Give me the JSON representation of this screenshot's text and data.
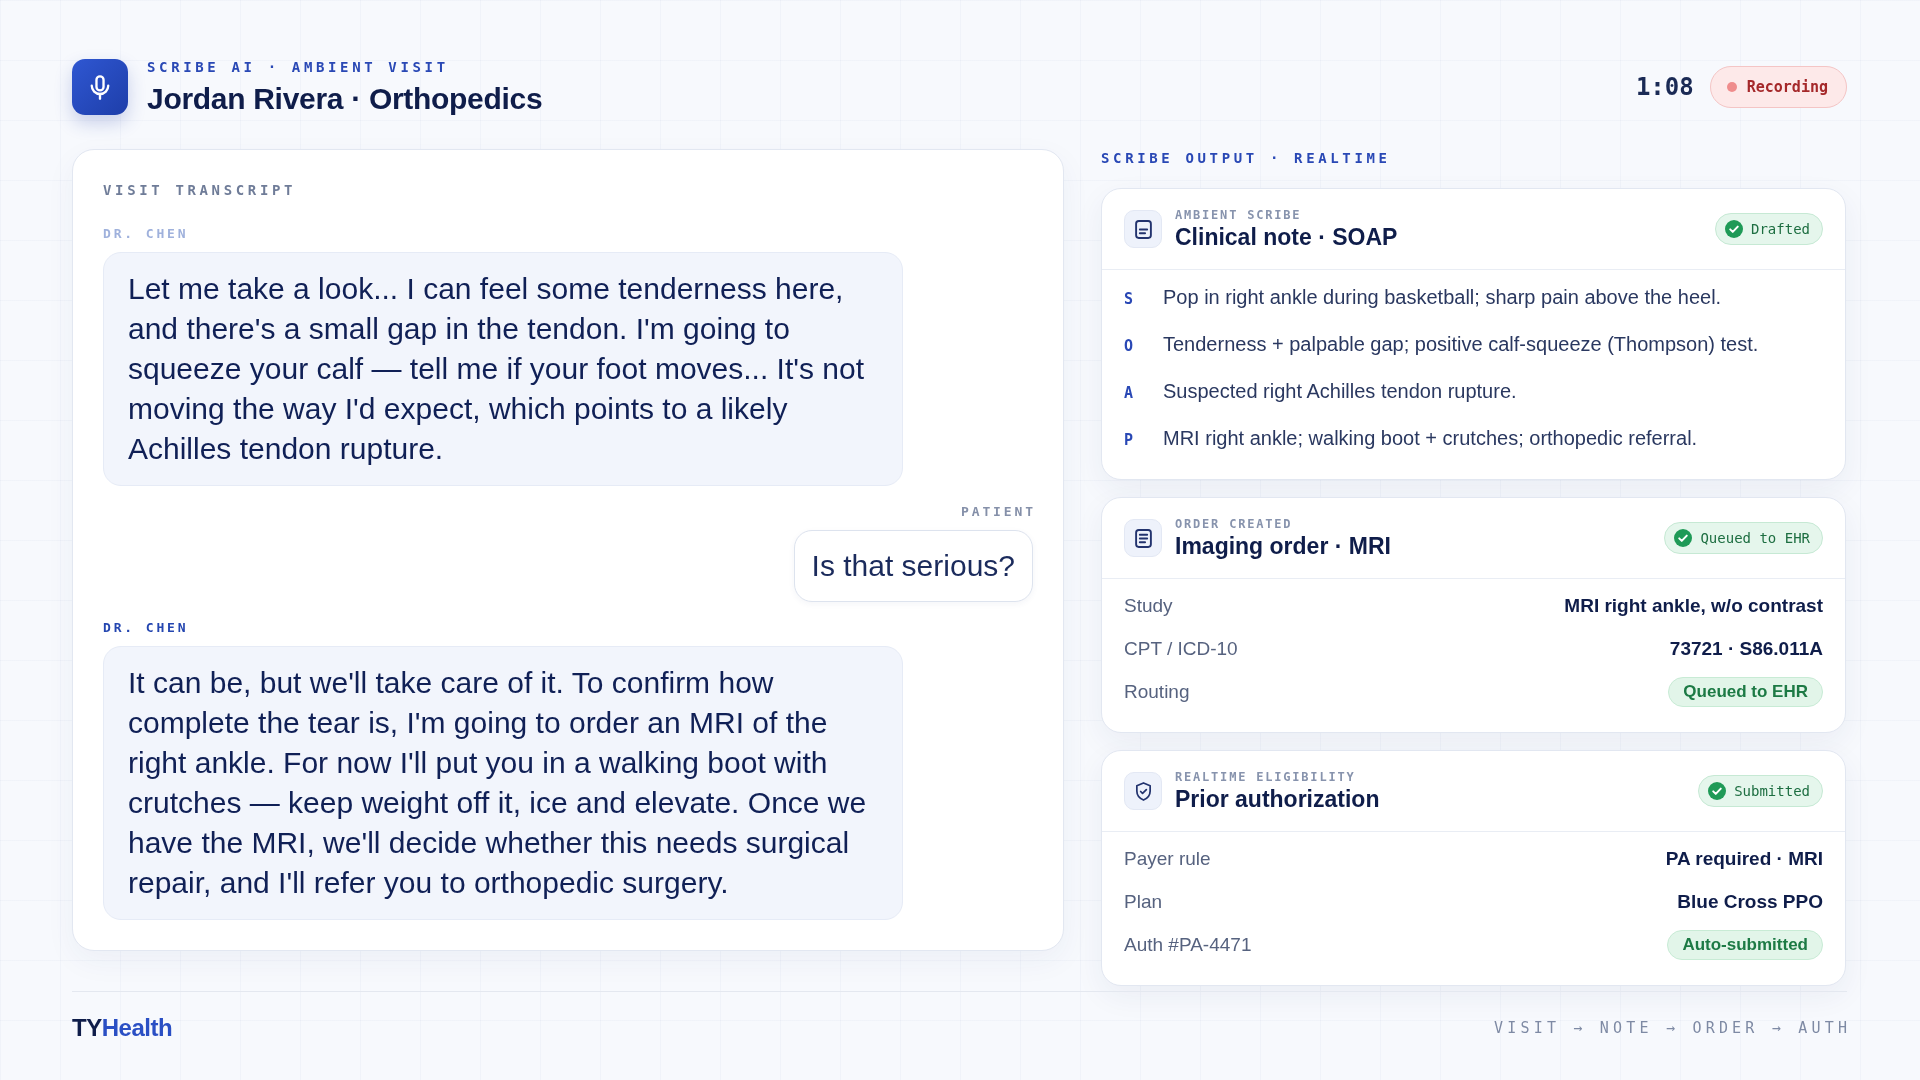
{
  "header": {
    "eyebrow": "SCRIBE AI · AMBIENT VISIT",
    "title": "Jordan Rivera · Orthopedics",
    "timer": "1:08",
    "status": {
      "label": "Recording",
      "recording": true
    }
  },
  "transcript": {
    "title": "VISIT TRANSCRIPT",
    "messages": [
      {
        "speaker": "DR. CHEN",
        "kind": "clinician",
        "active": false,
        "text": "Let me take a look... I can feel some tenderness here, and there's a small gap in the tendon. I'm going to squeeze your calf — tell me if your foot moves... It's not moving the way I'd expect, which points to a likely Achilles tendon rupture."
      },
      {
        "speaker": "PATIENT",
        "kind": "patient",
        "active": false,
        "text": "Is that serious?"
      },
      {
        "speaker": "DR. CHEN",
        "kind": "clinician",
        "active": true,
        "text": "It can be, but we'll take care of it. To confirm how complete the tear is, I'm going to order an MRI of the right ankle. For now I'll put you in a walking boot with crutches — keep weight off it, ice and elevate. Once we have the MRI, we'll decide whether this needs surgical repair, and I'll refer you to orthopedic surgery."
      }
    ]
  },
  "output": {
    "title": "SCRIBE OUTPUT · REALTIME",
    "cards": [
      {
        "kind": "soap",
        "eyebrow": "AMBIENT SCRIBE",
        "title": "Clinical note · SOAP",
        "badge": {
          "label": "Drafted",
          "complete": true
        },
        "lines": [
          {
            "letter": "S",
            "text": "Pop in right ankle during basketball; sharp pain above the heel."
          },
          {
            "letter": "O",
            "text": "Tenderness + palpable gap; positive calf-squeeze (Thompson) test."
          },
          {
            "letter": "A",
            "text": "Suspected right Achilles tendon rupture."
          },
          {
            "letter": "P",
            "text": "MRI right ankle; walking boot + crutches; orthopedic referral."
          }
        ]
      },
      {
        "kind": "order",
        "eyebrow": "ORDER CREATED",
        "title": "Imaging order · MRI",
        "badge": {
          "label": "Queued to EHR",
          "complete": true
        },
        "rows": [
          {
            "label": "Study",
            "value": "MRI right ankle, w/o contrast",
            "kind": "text"
          },
          {
            "label": "CPT / ICD-10",
            "value": "73721 · S86.011A",
            "kind": "text"
          },
          {
            "label": "Routing",
            "value": "Queued to EHR",
            "kind": "pill"
          }
        ]
      },
      {
        "kind": "authorization",
        "eyebrow": "REALTIME ELIGIBILITY",
        "title": "Prior authorization",
        "badge": {
          "label": "Submitted",
          "complete": true
        },
        "rows": [
          {
            "label": "Payer rule",
            "value": "PA required · MRI",
            "kind": "text"
          },
          {
            "label": "Plan",
            "value": "Blue Cross PPO",
            "kind": "text"
          },
          {
            "label": "Auth #PA-4471",
            "value": "Auto-submitted",
            "kind": "pill"
          }
        ]
      }
    ]
  },
  "footer": {
    "brand": {
      "lead": "TY",
      "rest": "Health"
    },
    "flow": "VISIT → NOTE → ORDER → AUTH"
  }
}
